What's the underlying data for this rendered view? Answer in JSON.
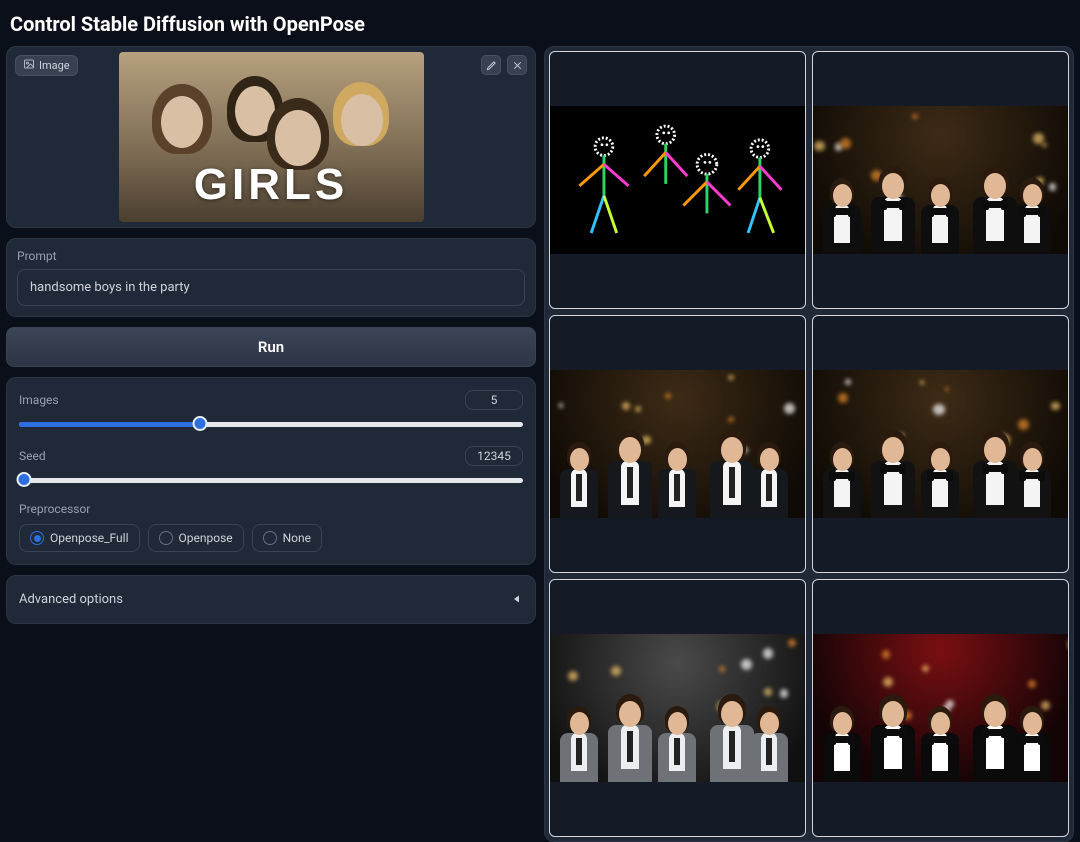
{
  "title": "Control Stable Diffusion with OpenPose",
  "image_chip_label": "Image",
  "uploaded_image_overlay_text": "GIRLS",
  "prompt": {
    "label": "Prompt",
    "value": "handsome boys in the party"
  },
  "run_label": "Run",
  "sliders": {
    "images": {
      "label": "Images",
      "value": 5,
      "min": 1,
      "max": 12,
      "fill_pct": 36,
      "thumb_pct": 36
    },
    "seed": {
      "label": "Seed",
      "value": 12345,
      "min": 0,
      "max": 400000,
      "fill_pct": 1,
      "thumb_pct": 1
    }
  },
  "preprocessor": {
    "label": "Preprocessor",
    "options": [
      "Openpose_Full",
      "Openpose",
      "None"
    ],
    "selected": "Openpose_Full"
  },
  "advanced_label": "Advanced options",
  "gallery": {
    "cells": [
      {
        "kind": "openpose_skeleton"
      },
      {
        "kind": "boys_party",
        "variant": "tux_warm"
      },
      {
        "kind": "boys_party",
        "variant": "suit_tie_warm"
      },
      {
        "kind": "boys_party",
        "variant": "tux_warm2"
      },
      {
        "kind": "boys_party",
        "variant": "grey_suit"
      },
      {
        "kind": "boys_party",
        "variant": "tux_red"
      }
    ]
  },
  "icons": {
    "edit": "pencil-icon",
    "close": "close-icon",
    "triangle": "triangle-left-icon"
  }
}
